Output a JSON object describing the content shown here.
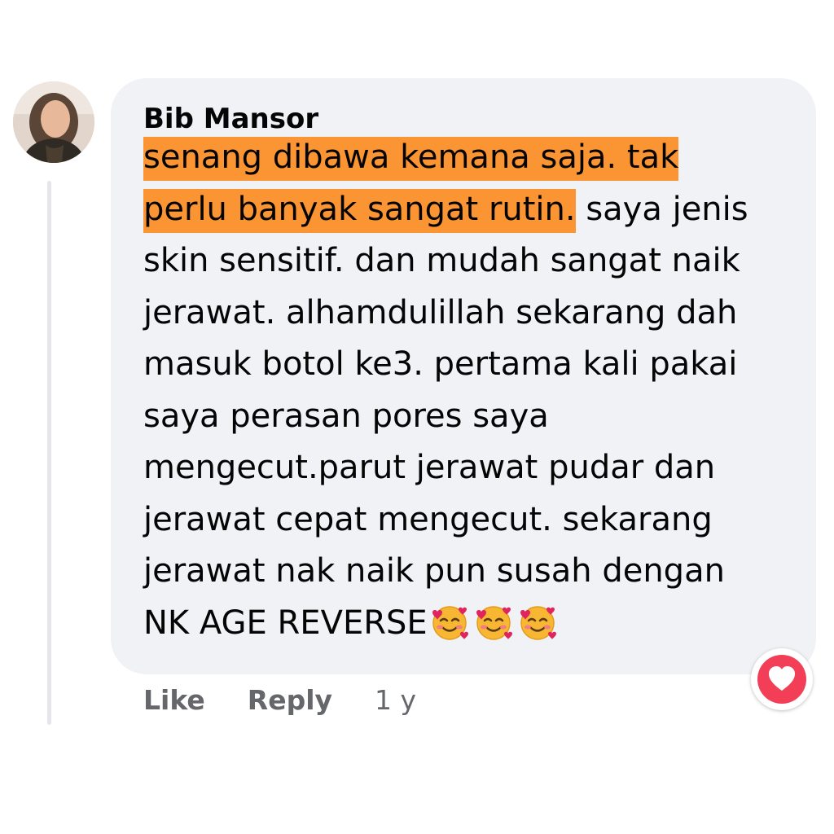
{
  "comment": {
    "author": "Bib Mansor",
    "highlighted_text": "senang dibawa kemana saja. tak perlu banyak sangat rutin.",
    "body_text": " saya jenis skin sensitif. dan mudah sangat naik jerawat. alhamdulillah sekarang dah masuk botol ke3. pertama kali pakai saya perasan pores saya mengecut.parut jerawat pudar dan jerawat cepat mengecut. sekarang jerawat nak naik pun susah dengan NK AGE REVERSE",
    "emojis": [
      "smiling-face-with-hearts",
      "smiling-face-with-hearts",
      "smiling-face-with-hearts"
    ]
  },
  "actions": {
    "like_label": "Like",
    "reply_label": "Reply",
    "timestamp": "1 y"
  },
  "reaction": {
    "icon": "heart-icon",
    "color": "#f33e58"
  },
  "colors": {
    "bubble": "#f0f2f5",
    "highlight": "#fb9433",
    "text": "#050505",
    "secondary_text": "#65676b",
    "thread_line": "#e4e6eb"
  }
}
